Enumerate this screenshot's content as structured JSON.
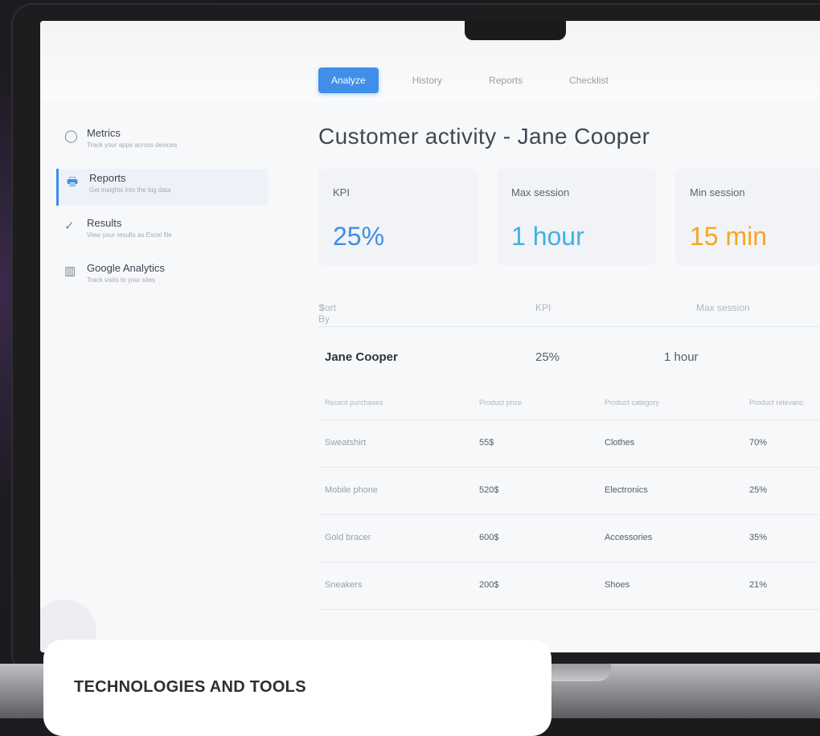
{
  "tabs": [
    "Analyze",
    "History",
    "Reports",
    "Checklist"
  ],
  "sidebar": {
    "items": [
      {
        "title": "Metrics",
        "sub": "Track your apps across devices",
        "icon": "circle-icon"
      },
      {
        "title": "Reports",
        "sub": "Get insights into the big data",
        "icon": "printer-icon"
      },
      {
        "title": "Results",
        "sub": "View your results as Excel file",
        "icon": "check-icon"
      },
      {
        "title": "Google Analytics",
        "sub": "Track visits to your sites",
        "icon": "bar-chart-icon"
      }
    ]
  },
  "heading": "Customer activity - Jane Cooper",
  "cards": [
    {
      "label": "KPI",
      "value": "25%",
      "color": "#3f8ee8"
    },
    {
      "label": "Max session",
      "value": "1 hour",
      "color": "#3fb1e3"
    },
    {
      "label": "Min session",
      "value": "15 min",
      "color": "#f5a623"
    }
  ],
  "sort": {
    "label": "Sort By",
    "col1": "KPI",
    "col2": "Max session"
  },
  "summary": {
    "name": "Jane Cooper",
    "kpi": "25%",
    "session": "1 hour"
  },
  "table": {
    "headers": [
      "Recent purchases",
      "Product price",
      "Product category",
      "Product relevanc"
    ],
    "rows": [
      [
        "Sweatshirt",
        "55$",
        "Clothes",
        "70%"
      ],
      [
        "Mobile phone",
        "520$",
        "Electronics",
        "25%"
      ],
      [
        "Gold bracer",
        "600$",
        "Accessories",
        "35%"
      ],
      [
        "Sneakers",
        "200$",
        "Shoes",
        "21%"
      ]
    ]
  },
  "overlay_title": "TECHNOLOGIES AND TOOLS"
}
